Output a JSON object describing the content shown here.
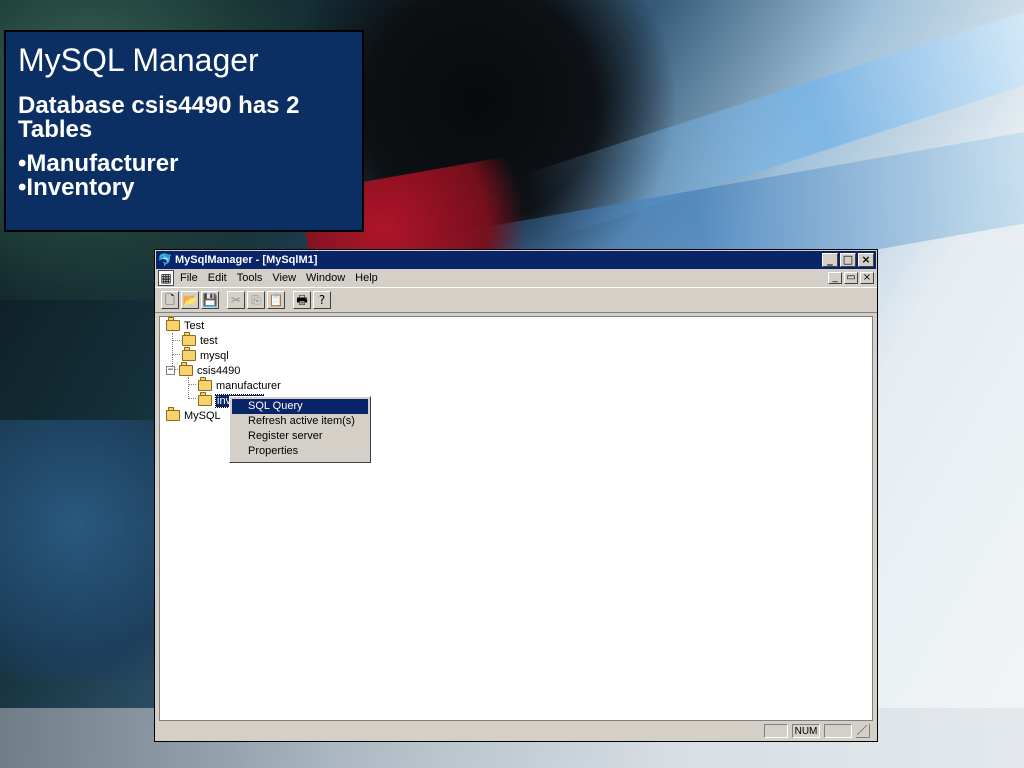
{
  "slide": {
    "title": "MySQL Manager",
    "subtitle": "Database csis4490 has 2 Tables",
    "bullets": [
      "•Manufacturer",
      "•Inventory"
    ]
  },
  "window": {
    "title": "MySqlManager - [MySqlM1]",
    "app_icon": "mysqlmanager-icon",
    "caption_buttons": {
      "minimize": "_",
      "maximize": "□",
      "close": "×"
    },
    "mdi_buttons": {
      "minimize": "_",
      "restore": "▭",
      "close": "×"
    }
  },
  "menubar": {
    "doc_icon": "document-icon",
    "items": [
      "File",
      "Edit",
      "Tools",
      "View",
      "Window",
      "Help"
    ]
  },
  "toolbar": {
    "buttons": [
      {
        "name": "new",
        "glyph": "🗋",
        "icon": "new-file-icon",
        "disabled": false
      },
      {
        "name": "open",
        "glyph": "📂",
        "icon": "open-folder-icon",
        "disabled": false
      },
      {
        "name": "save",
        "glyph": "💾",
        "icon": "save-icon",
        "disabled": false
      },
      {
        "name": "cut",
        "glyph": "✂",
        "icon": "cut-icon",
        "disabled": true
      },
      {
        "name": "copy",
        "glyph": "⎘",
        "icon": "copy-icon",
        "disabled": true
      },
      {
        "name": "paste",
        "glyph": "📋",
        "icon": "paste-icon",
        "disabled": true
      },
      {
        "name": "print",
        "glyph": "🖶",
        "icon": "print-icon",
        "disabled": false
      },
      {
        "name": "help",
        "glyph": "?",
        "icon": "help-icon",
        "disabled": false
      }
    ]
  },
  "tree": {
    "nodes": [
      {
        "label": "Test"
      },
      {
        "label": "test"
      },
      {
        "label": "mysql"
      },
      {
        "label": "csis4490",
        "expanded": true,
        "expander": "−"
      },
      {
        "label": "manufacturer"
      },
      {
        "label": "inventory",
        "selected": true
      },
      {
        "label": "MySQL"
      }
    ]
  },
  "context_menu": {
    "items": [
      {
        "label": "SQL Query",
        "active": true
      },
      {
        "label": "Refresh active item(s)",
        "active": false
      },
      {
        "label": "Register server",
        "active": false
      },
      {
        "label": "Properties",
        "active": false
      }
    ]
  },
  "statusbar": {
    "num": "NUM"
  }
}
